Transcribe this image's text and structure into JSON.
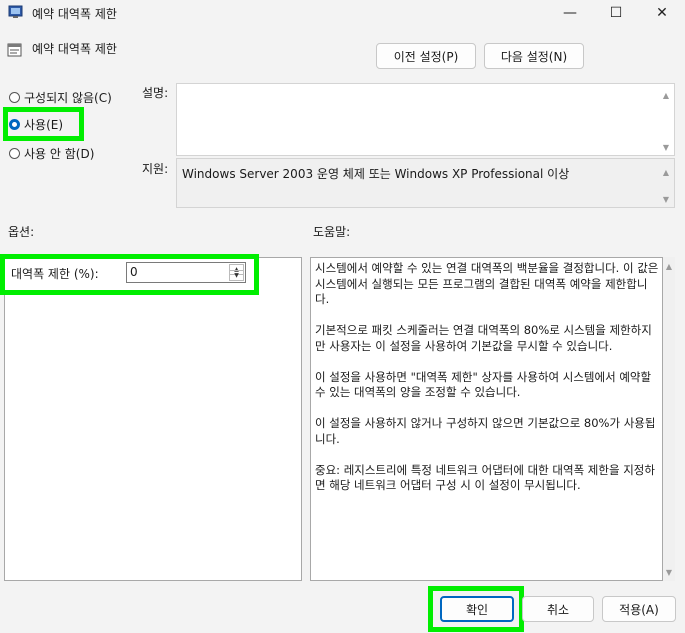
{
  "window": {
    "title": "예약 대역폭 제한",
    "minimize_glyph": "—",
    "maximize_glyph": "☐",
    "close_glyph": "✕"
  },
  "header": {
    "setting_name": "예약 대역폭 제한",
    "prev_button": "이전 설정(P)",
    "next_button": "다음 설정(N)"
  },
  "state": {
    "options": [
      {
        "label": "구성되지 않음(C)",
        "checked": false
      },
      {
        "label": "사용(E)",
        "checked": true
      },
      {
        "label": "사용 안 함(D)",
        "checked": false
      }
    ]
  },
  "comment": {
    "label": "설명:",
    "value": ""
  },
  "supported": {
    "label": "지원:",
    "value": "Windows Server 2003 운영 체제 또는 Windows XP Professional 이상"
  },
  "options_section": {
    "label": "옵션:",
    "bandwidth_label": "대역폭 제한 (%):",
    "bandwidth_value": "0"
  },
  "help_section": {
    "label": "도움말:",
    "text": "시스템에서 예약할 수 있는 연결 대역폭의 백분율을 결정합니다. 이 값은 시스템에서 실행되는 모든 프로그램의 결합된 대역폭 예약을 제한합니다.\n\n기본적으로 패킷 스케줄러는 연결 대역폭의 80%로 시스템을 제한하지만 사용자는 이 설정을 사용하여 기본값을 무시할 수 있습니다.\n\n이 설정을 사용하면 \"대역폭 제한\" 상자를 사용하여 시스템에서 예약할 수 있는 대역폭의 양을 조정할 수 있습니다.\n\n이 설정을 사용하지 않거나 구성하지 않으면 기본값으로 80%가 사용됩니다.\n\n중요: 레지스트리에 특정 네트워크 어댑터에 대한 대역폭 제한을 지정하면 해당 네트워크 어댑터 구성 시 이 설정이 무시됩니다."
  },
  "footer": {
    "ok": "확인",
    "cancel": "취소",
    "apply": "적용(A)"
  },
  "colors": {
    "highlight": "#00ee00",
    "accent": "#0067c0"
  }
}
